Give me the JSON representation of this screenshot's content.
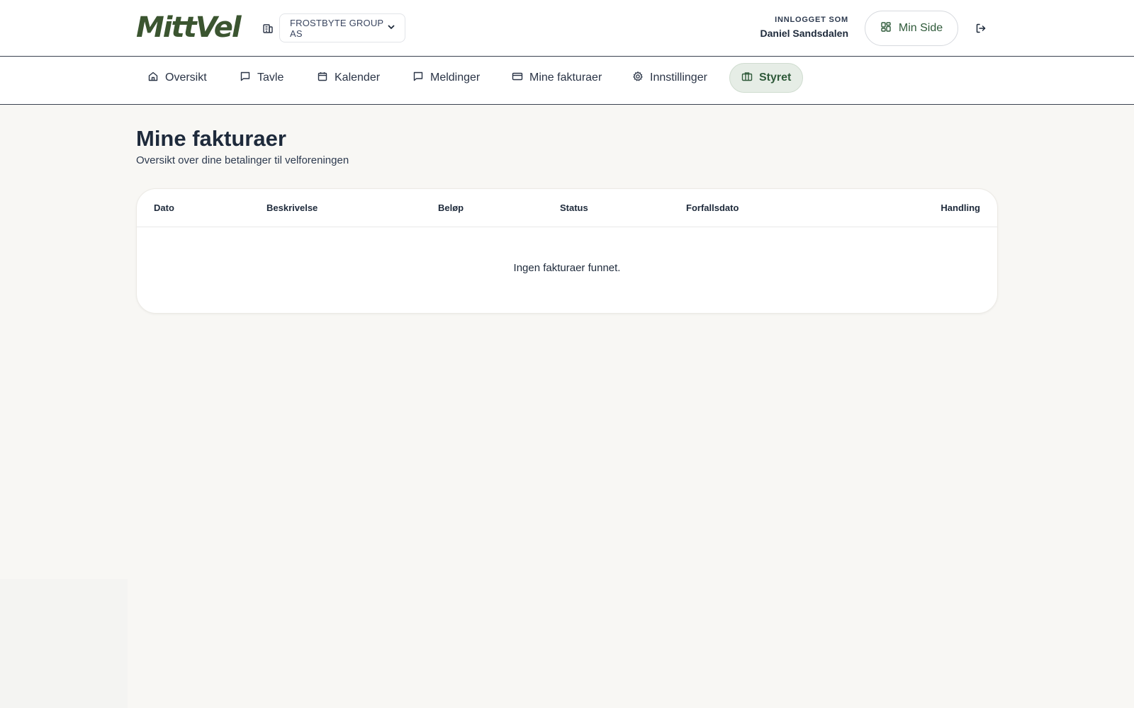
{
  "brand": {
    "logo_text": "MittVel",
    "accent": "#3b5530"
  },
  "header": {
    "org_select_value": "FROSTBYTE GROUP AS",
    "logged_in_label": "INNLOGGET SOM",
    "logged_in_name": "Daniel Sandsdalen",
    "min_side_label": "Min Side"
  },
  "nav": {
    "items": [
      {
        "label": "Oversikt",
        "icon": "home-icon"
      },
      {
        "label": "Tavle",
        "icon": "message-square-icon"
      },
      {
        "label": "Kalender",
        "icon": "calendar-icon"
      },
      {
        "label": "Meldinger",
        "icon": "message-square-icon"
      },
      {
        "label": "Mine fakturaer",
        "icon": "credit-card-icon"
      },
      {
        "label": "Innstillinger",
        "icon": "gear-icon"
      },
      {
        "label": "Styret",
        "icon": "briefcase-icon",
        "active": true
      }
    ]
  },
  "main": {
    "title": "Mine fakturaer",
    "subtitle": "Oversikt over dine betalinger til velforeningen",
    "table": {
      "columns": [
        "Dato",
        "Beskrivelse",
        "Beløp",
        "Status",
        "Forfallsdato",
        "Handling"
      ],
      "rows": [],
      "empty_message": "Ingen fakturaer funnet."
    }
  }
}
